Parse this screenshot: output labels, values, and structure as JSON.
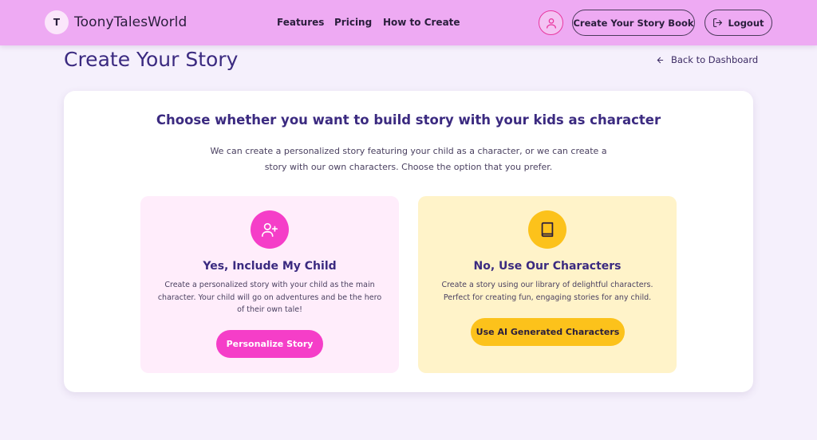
{
  "brand": {
    "initial": "T",
    "name": "ToonyTalesWorld"
  },
  "nav": {
    "features": "Features",
    "pricing": "Pricing",
    "how_to_create": "How to Create"
  },
  "header_actions": {
    "create_label": "Create Your Story Book",
    "logout_label": "Logout",
    "profile_icon": "user-icon",
    "logout_icon": "logout-icon"
  },
  "page": {
    "title": "Create Your Story",
    "back_label": "Back to Dashboard",
    "back_icon": "arrow-left-icon"
  },
  "card": {
    "title": "Choose whether you want to build story with your kids as character",
    "description": "We can create a personalized story featuring your child as a character, or we can create a story with our own characters. Choose the option that you prefer."
  },
  "options": [
    {
      "icon": "user-plus-icon",
      "title": "Yes, Include My Child",
      "description": "Create a personalized story with your child as the main character. Your child will go on adventures and be the hero of their own tale!",
      "button": "Personalize Story",
      "color": "#f53ec8"
    },
    {
      "icon": "book-icon",
      "title": "No, Use Our Characters",
      "description": "Create a story using our library of delightful characters. Perfect for creating fun, engaging stories for any child.",
      "button": "Use AI Generated Characters",
      "color": "#fcc21b"
    }
  ],
  "colors": {
    "header_bg": "#eeaaf3",
    "page_bg": "#f5f0fc",
    "accent_pink": "#f53ec8",
    "accent_yellow": "#fcc21b",
    "title_purple": "#3b2a80"
  }
}
